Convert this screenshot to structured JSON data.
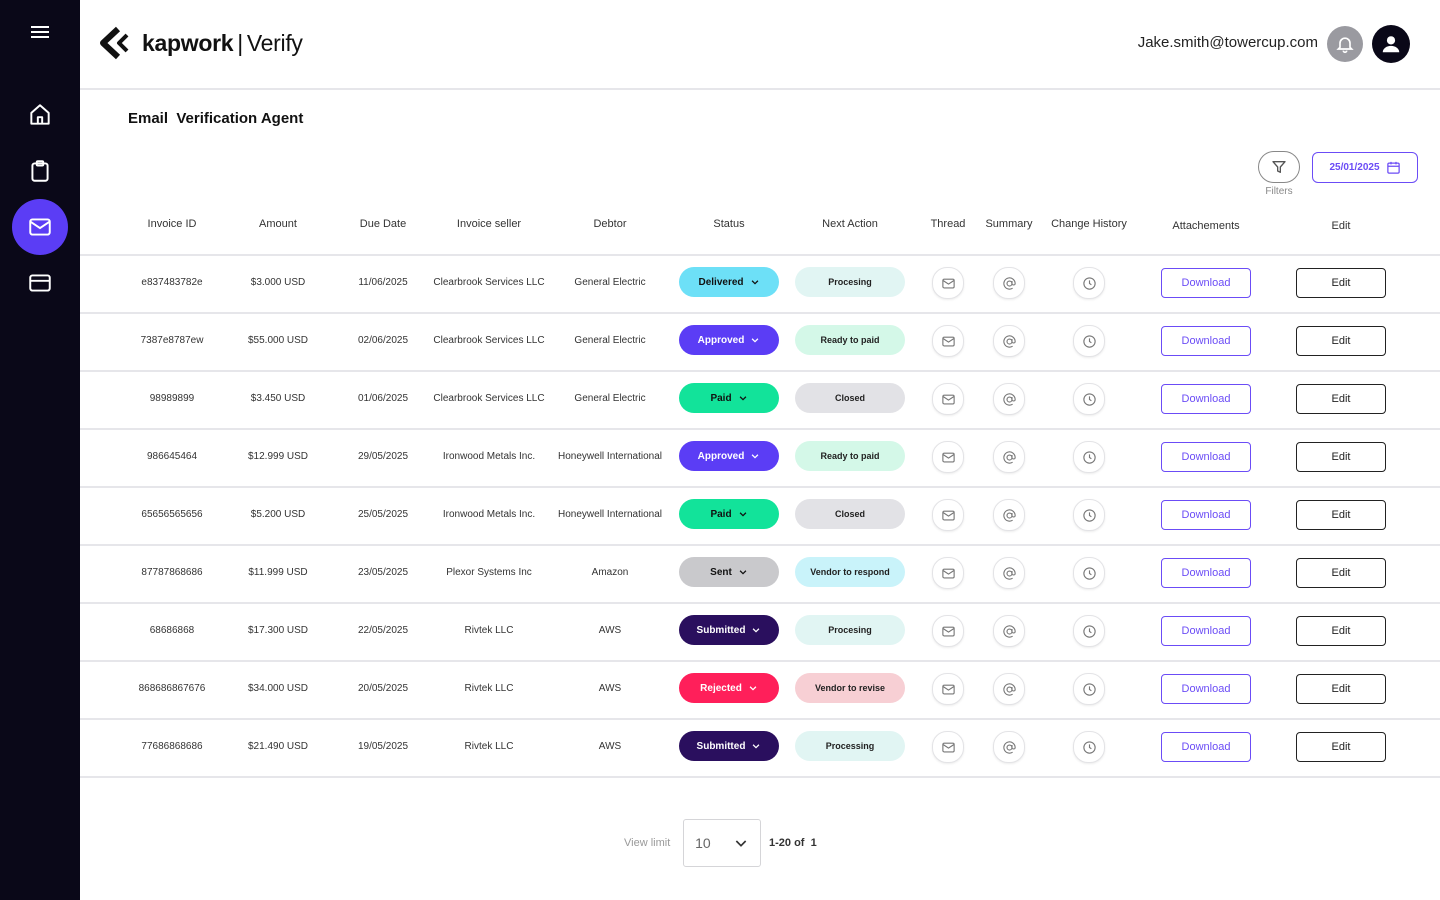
{
  "app": {
    "brand": "kapwork",
    "brand_separator": "|",
    "brand_product": "Verify"
  },
  "header": {
    "user_email": "Jake.smith@towercup.com"
  },
  "sidebar": {
    "items": [
      {
        "icon": "home-icon",
        "active": false
      },
      {
        "icon": "clipboard-icon",
        "active": false
      },
      {
        "icon": "mail-icon",
        "active": true
      },
      {
        "icon": "card-icon",
        "active": false
      }
    ]
  },
  "page": {
    "title": "Email  Verification Agent"
  },
  "toolbar": {
    "filters_label": "Filters",
    "date_value": "25/01/2025"
  },
  "table": {
    "columns": [
      "Invoice ID",
      "Amount",
      "Due Date",
      "Invoice seller",
      "Debtor",
      "Status",
      "Next Action",
      "Thread",
      "Summary",
      "Change History",
      "Attachements",
      "Edit"
    ],
    "download_label": "Download",
    "edit_label": "Edit",
    "rows": [
      {
        "id": "e837483782e",
        "amount": "$3.000 USD",
        "due": "11/06/2025",
        "seller": "Clearbrook Services LLC",
        "debtor": "General Electric",
        "status": "Delivered",
        "next": "Procesing"
      },
      {
        "id": "7387e8787ew",
        "amount": "$55.000 USD",
        "due": "02/06/2025",
        "seller": "Clearbrook Services LLC",
        "debtor": "General Electric",
        "status": "Approved",
        "next": "Ready to paid"
      },
      {
        "id": "98989899",
        "amount": "$3.450 USD",
        "due": "01/06/2025",
        "seller": "Clearbrook Services LLC",
        "debtor": "General Electric",
        "status": "Paid",
        "next": "Closed"
      },
      {
        "id": "986645464",
        "amount": "$12.999 USD",
        "due": "29/05/2025",
        "seller": "Ironwood Metals Inc.",
        "debtor": "Honeywell International",
        "status": "Approved",
        "next": "Ready to paid"
      },
      {
        "id": "65656565656",
        "amount": "$5.200 USD",
        "due": "25/05/2025",
        "seller": "Ironwood Metals Inc.",
        "debtor": "Honeywell International",
        "status": "Paid",
        "next": "Closed"
      },
      {
        "id": "87787868686",
        "amount": "$11.999 USD",
        "due": "23/05/2025",
        "seller": "Plexor Systems Inc",
        "debtor": "Amazon",
        "status": "Sent",
        "next": "Vendor to respond"
      },
      {
        "id": "68686868",
        "amount": "$17.300 USD",
        "due": "22/05/2025",
        "seller": "Rivtek LLC",
        "debtor": "AWS",
        "status": "Submitted",
        "next": "Procesing"
      },
      {
        "id": "868686867676",
        "amount": "$34.000 USD",
        "due": "20/05/2025",
        "seller": "Rivtek LLC",
        "debtor": "AWS",
        "status": "Rejected",
        "next": "Vendor to revise"
      },
      {
        "id": "77686868686",
        "amount": "$21.490 USD",
        "due": "19/05/2025",
        "seller": "Rivtek LLC",
        "debtor": "AWS",
        "status": "Submitted",
        "next": "Processing"
      }
    ]
  },
  "status_colors": {
    "Delivered": {
      "bg": "#6de0f7",
      "fg": "#111111"
    },
    "Approved": {
      "bg": "#5b3df5",
      "fg": "#ffffff"
    },
    "Paid": {
      "bg": "#12e39a",
      "fg": "#111111"
    },
    "Sent": {
      "bg": "#c9c9cc",
      "fg": "#111111"
    },
    "Submitted": {
      "bg": "#2a0f5e",
      "fg": "#ffffff"
    },
    "Rejected": {
      "bg": "#ff1f5a",
      "fg": "#ffffff"
    }
  },
  "next_colors": {
    "Procesing": "#e1f5f3",
    "Processing": "#e1f5f3",
    "Ready to paid": "#d4f8e8",
    "Closed": "#e2e2e6",
    "Vendor to respond": "#c9f3fa",
    "Vendor to revise": "#f7cfd4"
  },
  "pagination": {
    "label": "View limit",
    "limit": "10",
    "range": "1-20 of  1"
  }
}
